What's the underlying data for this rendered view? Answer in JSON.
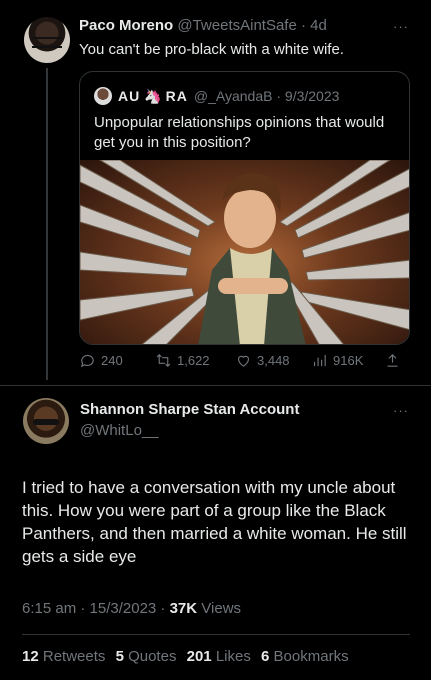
{
  "tweet1": {
    "author_name": "Paco Moreno",
    "author_handle": "@TweetsAintSafe",
    "time": "· 4d",
    "more": "···",
    "text": "You can't be pro-black with a white wife.",
    "quote": {
      "name_part1": "AU",
      "name_emoji": "🦄",
      "name_part2": "RA",
      "handle_date": "@_AyandaB · 9/3/2023",
      "text": "Unpopular relationships opinions that would get you in this position?"
    },
    "actions": {
      "replies": "240",
      "retweets": "1,622",
      "likes": "3,448",
      "views": "916K"
    }
  },
  "tweet2": {
    "author_name": "Shannon Sharpe Stan Account",
    "author_handle": "@WhitLo__",
    "more": "···",
    "text": "I tried to have a conversation with my uncle about this. How you were part of a group like the Black Panthers, and then married a white woman. He still gets a side eye",
    "timestamp": "6:15 am · 15/3/2023 · ",
    "views_count": "37K",
    "views_label": " Views",
    "stats": {
      "retweets_count": "12",
      "retweets_label": "Retweets",
      "quotes_count": "5",
      "quotes_label": "Quotes",
      "likes_count": "201",
      "likes_label": "Likes",
      "bookmarks_count": "6",
      "bookmarks_label": "Bookmarks"
    }
  },
  "colors": {
    "background": "#000000",
    "text_primary": "#e7e9ea",
    "text_secondary": "#71767b",
    "border": "#2f3336"
  }
}
